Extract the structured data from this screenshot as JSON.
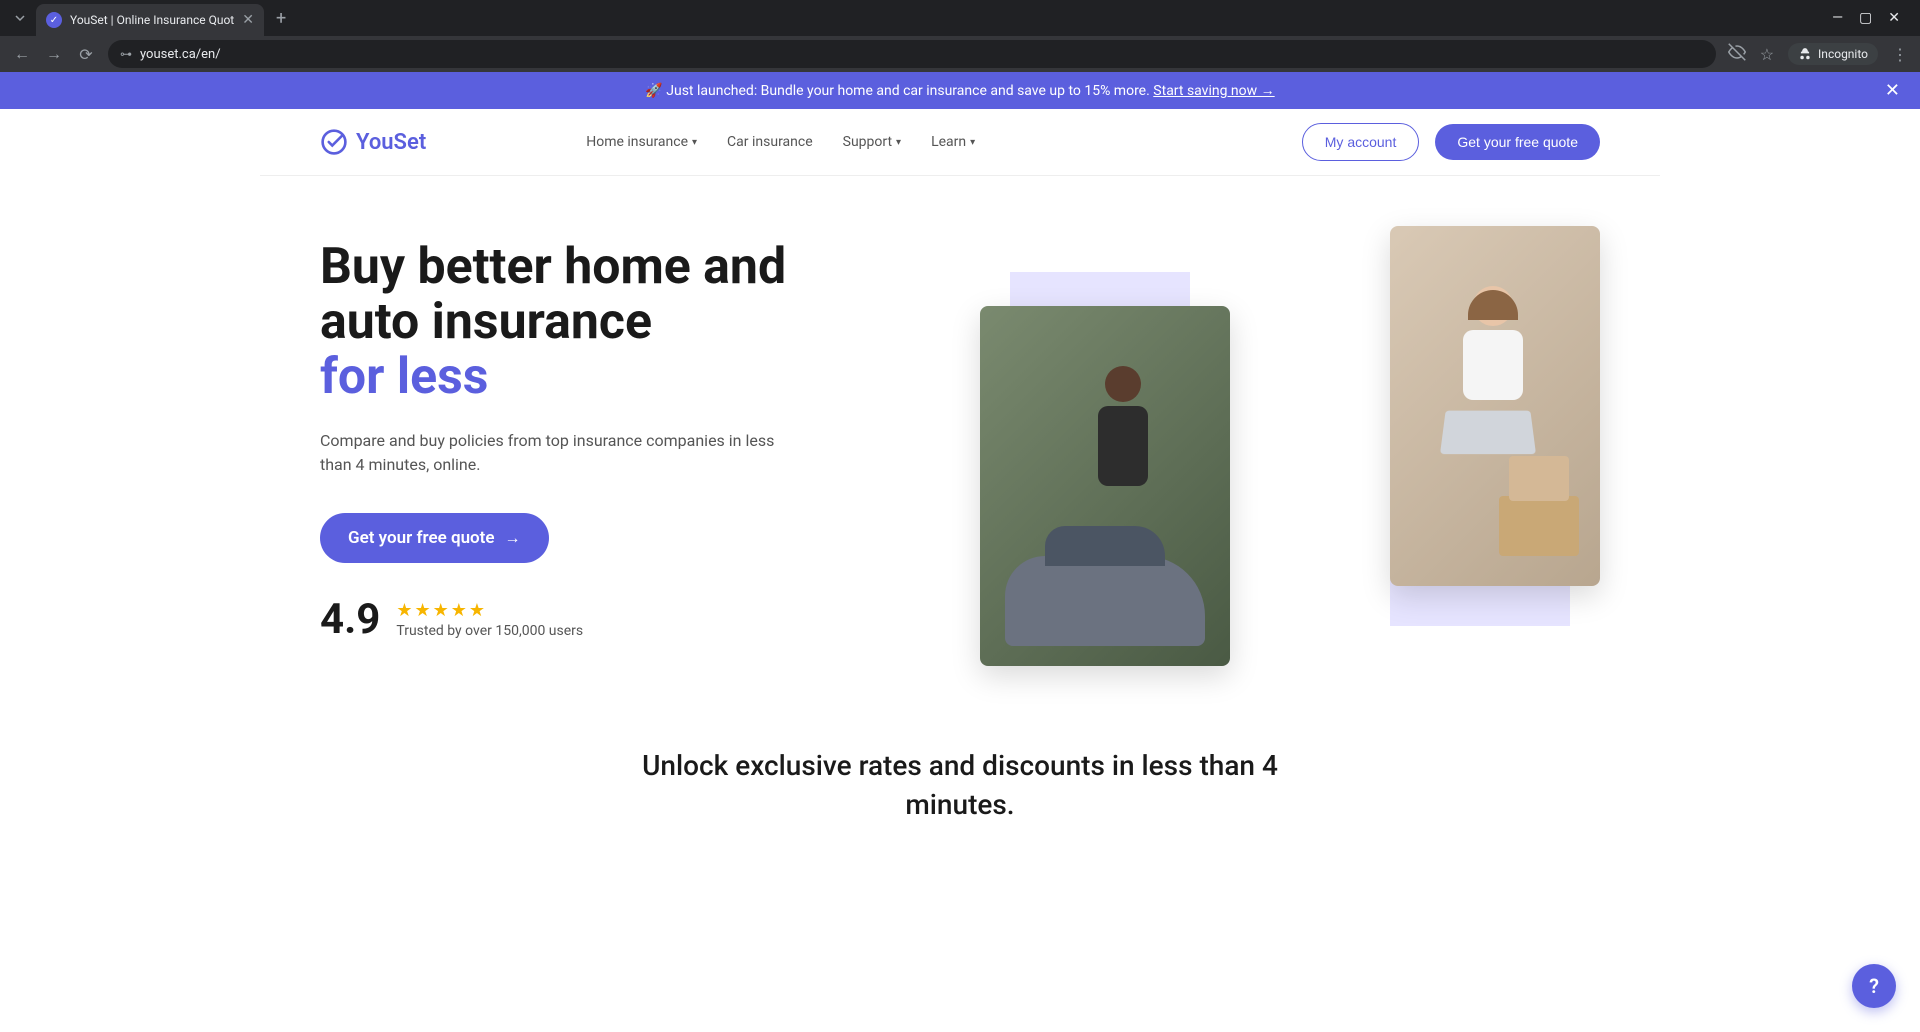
{
  "browser": {
    "tab_title": "YouSet | Online Insurance Quot",
    "url": "youset.ca/en/",
    "incognito_label": "Incognito"
  },
  "promo": {
    "emoji": "🚀",
    "text": "Just launched: Bundle your home and car insurance and save up to 15% more.",
    "link": "Start saving now →"
  },
  "header": {
    "logo": "YouSet",
    "nav": {
      "home_insurance": "Home insurance",
      "car_insurance": "Car insurance",
      "support": "Support",
      "learn": "Learn"
    },
    "my_account": "My account",
    "cta": "Get your free quote"
  },
  "hero": {
    "title_line1": "Buy better home and",
    "title_line2": "auto insurance",
    "title_accent": "for less",
    "subtitle": "Compare and buy policies from top insurance companies in less than 4 minutes, online.",
    "cta": "Get your free quote",
    "rating_value": "4.9",
    "rating_text": "Trusted by over 150,000 users"
  },
  "tagline": "Unlock exclusive rates and discounts in less than 4 minutes.",
  "help": "?"
}
